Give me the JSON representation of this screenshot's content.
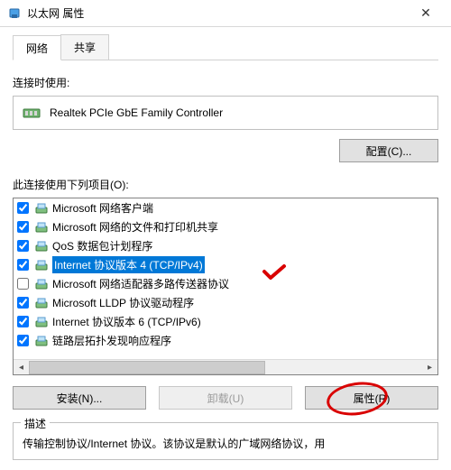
{
  "window": {
    "title": "以太网 属性",
    "close_glyph": "✕"
  },
  "tabs": {
    "network": "网络",
    "sharing": "共享"
  },
  "connect_using_label": "连接时使用:",
  "adapter": {
    "name": "Realtek PCIe GbE Family Controller"
  },
  "configure_btn": "配置(C)...",
  "items_label": "此连接使用下列项目(O):",
  "items": [
    {
      "checked": true,
      "label": "Microsoft 网络客户端"
    },
    {
      "checked": true,
      "label": "Microsoft 网络的文件和打印机共享"
    },
    {
      "checked": true,
      "label": "QoS 数据包计划程序"
    },
    {
      "checked": true,
      "label": "Internet 协议版本 4 (TCP/IPv4)",
      "selected": true
    },
    {
      "checked": false,
      "label": "Microsoft 网络适配器多路传送器协议"
    },
    {
      "checked": true,
      "label": "Microsoft LLDP 协议驱动程序"
    },
    {
      "checked": true,
      "label": "Internet 协议版本 6 (TCP/IPv6)"
    },
    {
      "checked": true,
      "label": "链路层拓扑发现响应程序"
    }
  ],
  "buttons": {
    "install": "安装(N)...",
    "uninstall": "卸载(U)",
    "properties": "属性(R)"
  },
  "description": {
    "title": "描述",
    "text": "传输控制协议/Internet 协议。该协议是默认的广域网络协议，用"
  }
}
